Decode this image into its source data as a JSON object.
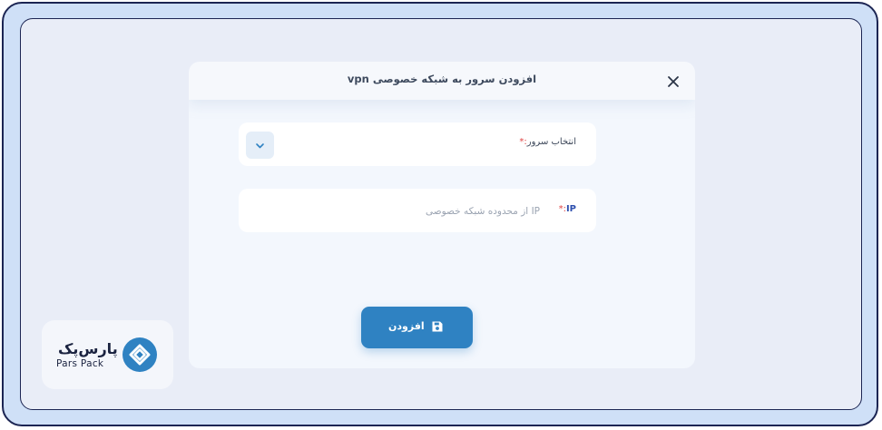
{
  "dialog": {
    "title": "افزودن سرور به شبکه خصوصی vpn",
    "close_icon": "close-icon"
  },
  "form": {
    "server_select": {
      "label": "انتخاب سرور",
      "required_mark": ":*",
      "dropdown_icon": "chevron-down-icon",
      "value": ""
    },
    "ip_field": {
      "label": "IP",
      "required_mark": ":*",
      "placeholder": "IP از محدوده شبکه خصوصی",
      "value": ""
    },
    "submit": {
      "label": "افزودن",
      "icon": "save-icon",
      "color": "#2f82c2"
    }
  },
  "branding": {
    "name_fa": "پارس‌پک",
    "name_en": "Pars Pack",
    "mark_icon": "parspack-logo-icon",
    "color": "#2f82c2"
  }
}
